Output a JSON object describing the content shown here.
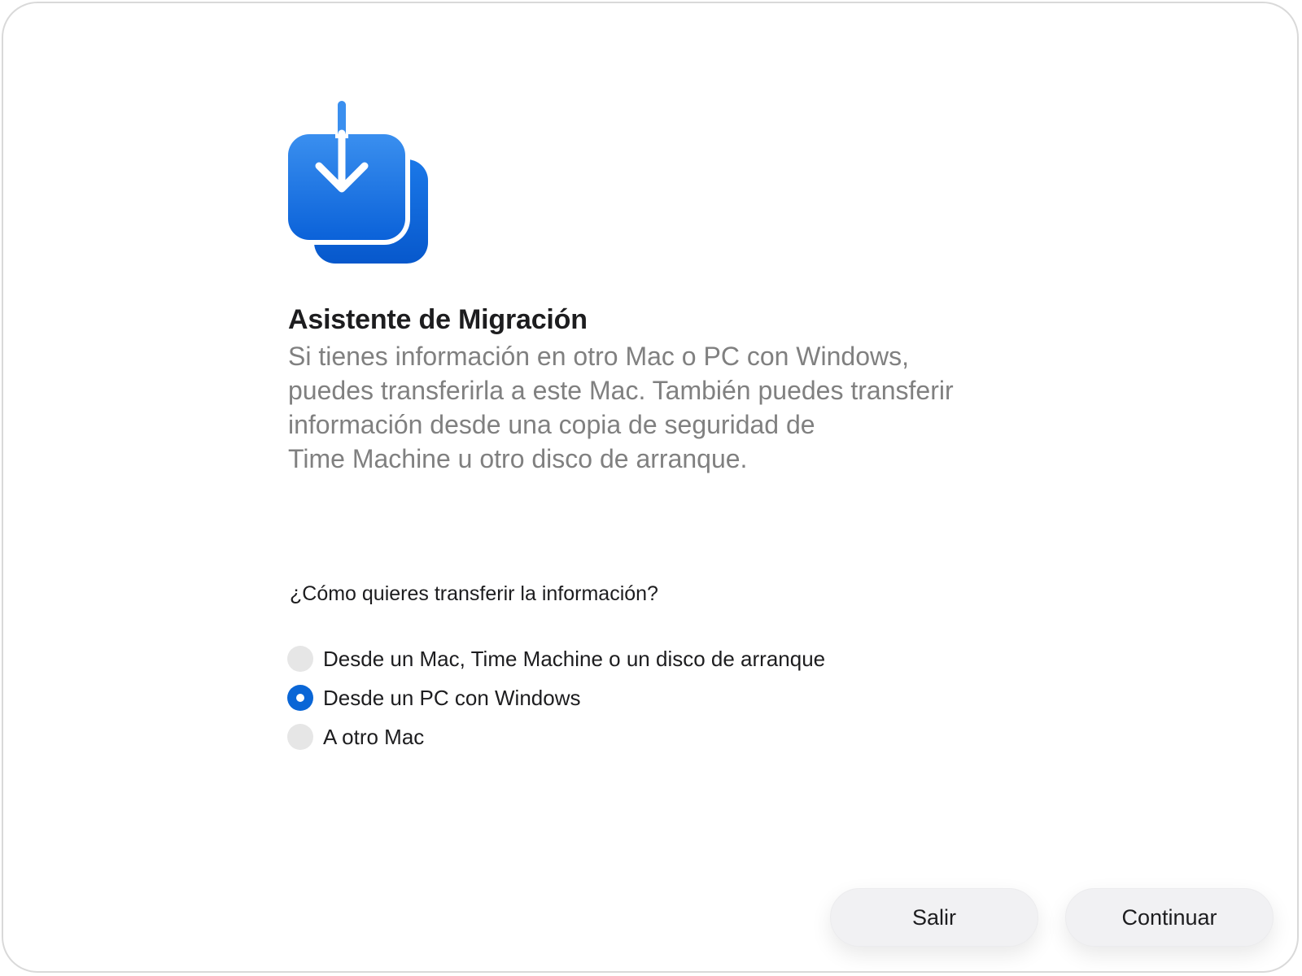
{
  "app": {
    "title": "Asistente de Migración",
    "icon": "migration-assistant-icon",
    "accent_color": "#0a66d6"
  },
  "intro": {
    "lines": [
      "Si tienes información en otro Mac o PC con Windows,",
      "puedes transferirla a este Mac. También puedes transferir",
      "información desde una copia de seguridad de",
      "Time Machine u otro disco de arranque."
    ]
  },
  "transfer": {
    "question": "¿Cómo quieres transferir la información?",
    "options": [
      {
        "label": "Desde un Mac, Time Machine o un disco de arranque",
        "selected": false
      },
      {
        "label": "Desde un PC con Windows",
        "selected": true
      },
      {
        "label": "A otro Mac",
        "selected": false
      }
    ]
  },
  "footer": {
    "quit_label": "Salir",
    "continue_label": "Continuar"
  }
}
